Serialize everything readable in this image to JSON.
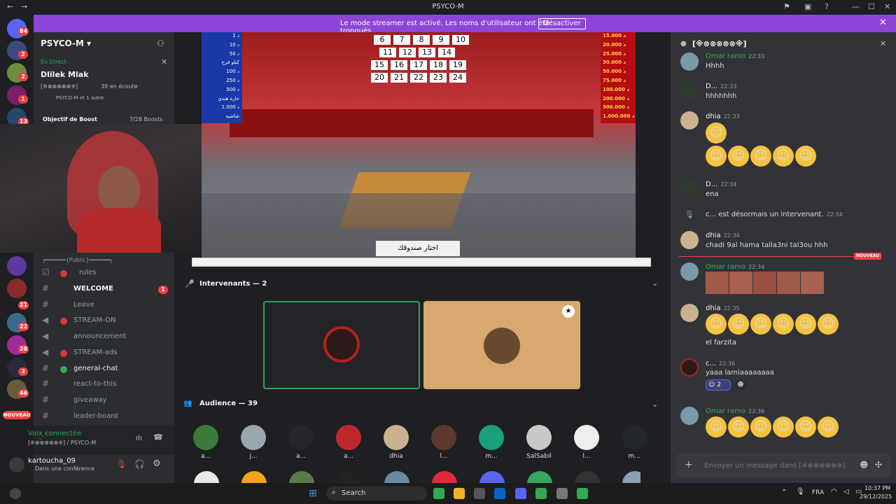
{
  "window": {
    "title": "PSYCO-M"
  },
  "banner": {
    "message": "Le mode streamer est activé. Les noms d'utilisateur ont été tronqués.",
    "button": "Désactiver"
  },
  "servers": {
    "badges": [
      "84",
      "2",
      "2",
      "1",
      "1",
      "13",
      "21",
      "22",
      "28",
      "3",
      "46"
    ],
    "new_label": "NOUVEAU"
  },
  "sidebar": {
    "server_name": "PSYCO-M",
    "live_label": "En Direct",
    "event_title": "Dlilek Mlak",
    "event_channel": "[※⊗⊗⊗⊗⊗※]",
    "listeners": "39 en écoute",
    "participants": "PSYCO-M et 1 autre",
    "boost_goal": "Objectif de Boost",
    "boost_count": "7/28 Boosts",
    "category": "┍━━━━━━{Public}━━━━━━┑",
    "channels": [
      {
        "name": "rules",
        "dot": "#da373c",
        "unread": ""
      },
      {
        "name": "WELCOME",
        "dot": "",
        "unread": "1"
      },
      {
        "name": "Leave",
        "dot": "",
        "unread": ""
      },
      {
        "name": "STREAM-ON",
        "dot": "#da373c",
        "unread": ""
      },
      {
        "name": "announcement",
        "dot": "",
        "unread": ""
      },
      {
        "name": "STREAM-ads",
        "dot": "#da373c",
        "unread": ""
      },
      {
        "name": "general-chat",
        "dot": "#3ba55c",
        "unread": ""
      },
      {
        "name": "react-to-this",
        "dot": "",
        "unread": ""
      },
      {
        "name": "giveaway",
        "dot": "",
        "unread": ""
      },
      {
        "name": "leader-board",
        "dot": "",
        "unread": ""
      }
    ],
    "voice_status": "Voix connectée",
    "voice_channel": "[※⊗⊗⊗⊗⊗※] / PSYCO-M",
    "user_name": "kartoucha_09",
    "user_status": "Dans une conférence"
  },
  "stream": {
    "prizes_left": [
      "1 د",
      "10 د",
      "50 د",
      "كيلو فرح",
      "100 د",
      "250 د",
      "500 د",
      "حارة هندي",
      "1.000 د",
      "شاشية"
    ],
    "prizes_right": [
      "15.000 د",
      "20.000 د",
      "25.000 د",
      "30.000 د",
      "50.000 د",
      "75.000 د",
      "100.000 د",
      "200.000 د",
      "300.000 د",
      "1.000.000 د"
    ],
    "numbers": [
      "6",
      "7",
      "8",
      "9",
      "10",
      "11",
      "12",
      "13",
      "14",
      "15",
      "16",
      "17",
      "18",
      "19",
      "20",
      "21",
      "22",
      "23",
      "24"
    ],
    "caption": "اختار صندوقك"
  },
  "stage": {
    "speakers_title": "Intervenants — 2",
    "audience_title": "Audience — 39"
  },
  "audience": [
    {
      "name": "a...",
      "color": "#3b7a3a"
    },
    {
      "name": "j...",
      "color": "#9aa7ad"
    },
    {
      "name": "a...",
      "color": "#26262a"
    },
    {
      "name": "a...",
      "color": "#c0282d"
    },
    {
      "name": "dhia",
      "color": "#c9b28e"
    },
    {
      "name": "l...",
      "color": "#5a3a2e"
    },
    {
      "name": "m...",
      "color": "#1aa07a"
    },
    {
      "name": "SalSabil",
      "color": "#c9c9c9"
    },
    {
      "name": "l...",
      "color": "#eeeeee"
    },
    {
      "name": "m...",
      "color": "#22252a"
    }
  ],
  "chat": {
    "channel": "[※⊗⊗⊗⊗⊗※]",
    "new_label": "NOUVEAU",
    "messages": [
      {
        "author": "Omar ramo",
        "time": "22:33",
        "text": "Hhhh"
      },
      {
        "author": "D...",
        "time": "22:33",
        "text": "hhhhhhh"
      },
      {
        "author": "dhia",
        "time": "22:33",
        "text": ""
      },
      {
        "author": "D...",
        "time": "22:34",
        "text": "ena"
      },
      {
        "author": "c...",
        "time": "22:34",
        "text": "est désormais un intervenant."
      },
      {
        "author": "dhia",
        "time": "22:34",
        "text": "chadi 9al hama talla3ni tal3ou hhh"
      },
      {
        "author": "Omar ramo",
        "time": "22:34",
        "text": ""
      },
      {
        "author": "dhia",
        "time": "22:35",
        "text": "el farzita"
      },
      {
        "author": "c...",
        "time": "22:36",
        "text": "yaaa lamiaaaaaaaa"
      },
      {
        "author": "Omar ramo",
        "time": "22:36",
        "text": ""
      }
    ],
    "reaction_count": "2",
    "input_placeholder": "Envoyer un message dans [※⊗⊗⊗⊗⊗※]"
  },
  "taskbar": {
    "search": "Search",
    "lang": "FRA",
    "time": "10:37 PM",
    "date": "29/12/2025"
  }
}
